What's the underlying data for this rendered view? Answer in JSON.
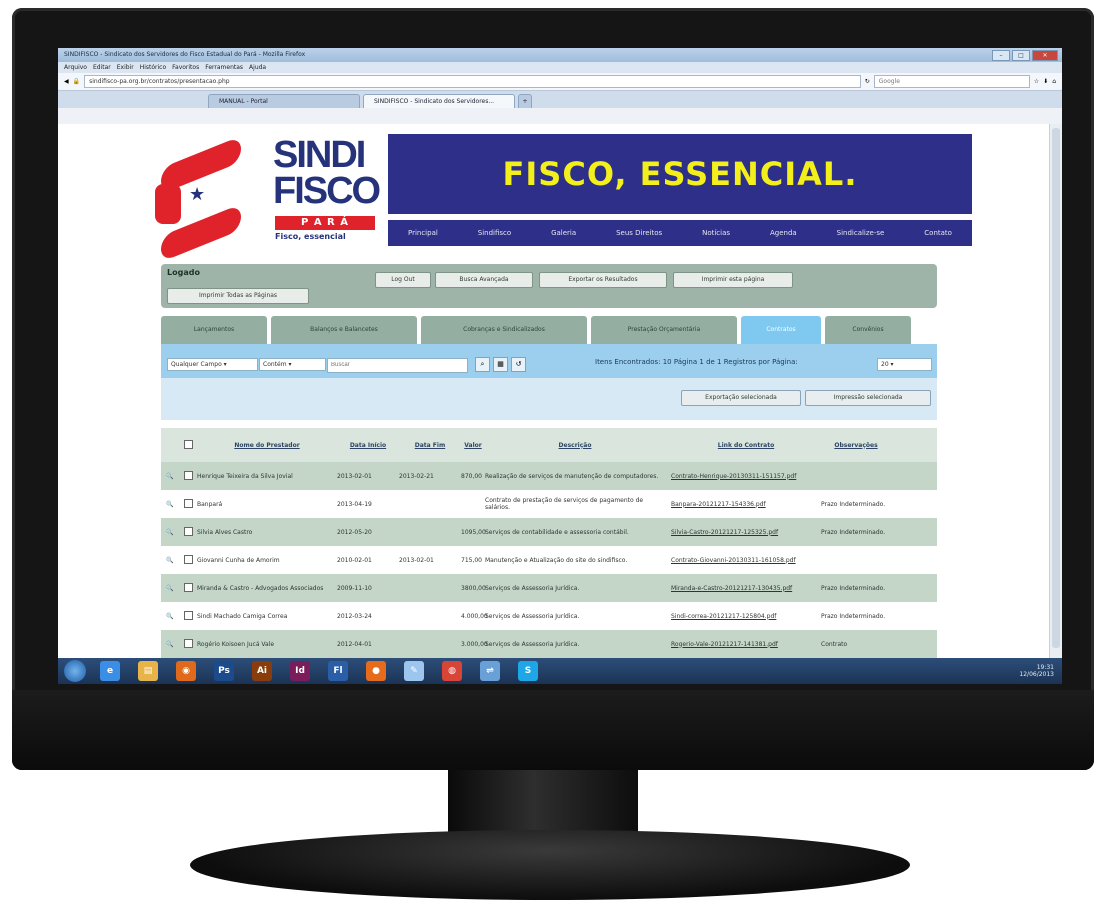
{
  "browser": {
    "window_title": "SINDIFISCO - Sindicato dos Servidores do Fisco Estadual do Pará - Mozilla Firefox",
    "menu": [
      "Arquivo",
      "Editar",
      "Exibir",
      "Histórico",
      "Favoritos",
      "Ferramentas",
      "Ajuda"
    ],
    "url": "sindifisco-pa.org.br/contratos/presentacao.php",
    "search_placeholder": "Google",
    "tabs": [
      {
        "label": "MANUAL - Portal"
      },
      {
        "label": "SINDIFISCO - Sindicato dos Servidores..."
      }
    ]
  },
  "site": {
    "logo": {
      "line1": "SINDI",
      "line2": "FISCO",
      "line3": "P A R Á",
      "tagline": "Fisco, essencial"
    },
    "banner": "FISCO, ESSENCIAL.",
    "nav": [
      "Principal",
      "Sindifisco",
      "Galeria",
      "Seus Direitos",
      "Notícias",
      "Agenda",
      "Sindicalize-se",
      "Contato"
    ]
  },
  "panel": {
    "status_label": "Logado",
    "buttons": [
      "Imprimir Todas as Páginas",
      "Log Out",
      "Busca Avançada",
      "Exportar os Resultados",
      "Imprimir esta página"
    ]
  },
  "subtabs": [
    {
      "label": "Lançamentos",
      "active": false
    },
    {
      "label": "Balanços e Balancetes",
      "active": false
    },
    {
      "label": "Cobranças e Sindicalizados",
      "active": false
    },
    {
      "label": "Prestação Orçamentária",
      "active": false
    },
    {
      "label": "Contratos",
      "active": true
    },
    {
      "label": "Convênios",
      "active": false
    }
  ],
  "filter": {
    "field": "Qualquer Campo",
    "operator": "Contém",
    "search_placeholder": "Buscar",
    "status": "Itens Encontrados: 10  Página 1 de 1   Registros por Página:",
    "per_page": "20"
  },
  "export_buttons": [
    "Exportação selecionada",
    "Impressão selecionada"
  ],
  "table": {
    "headers": [
      "Nome do Prestador",
      "Data Início",
      "Data Fim",
      "Valor",
      "Descrição",
      "Link do Contrato",
      "Observações"
    ],
    "rows": [
      {
        "name": "Henrique Teixeira da Silva Jovial",
        "start": "2013-02-01",
        "end": "2013-02-21",
        "value": "870,00",
        "desc": "Realização de serviços de manutenção de computadores.",
        "link": "Contrato-Henrique-20130311-151157.pdf",
        "obs": ""
      },
      {
        "name": "Banpará",
        "start": "2013-04-19",
        "end": "",
        "value": "",
        "desc": "Contrato de prestação de serviços de pagamento de salários.",
        "link": "Banpara-20121217-154336.pdf",
        "obs": "Prazo Indeterminado."
      },
      {
        "name": "Silvia Alves Castro",
        "start": "2012-05-20",
        "end": "",
        "value": "1095,00",
        "desc": "Serviços de contabilidade e assessoria contábil.",
        "link": "Silvia-Castro-20121217-125325.pdf",
        "obs": "Prazo Indeterminado."
      },
      {
        "name": "Giovanni Cunha de Amorim",
        "start": "2010-02-01",
        "end": "2013-02-01",
        "value": "715,00",
        "desc": "Manutenção e Atualização do site do sindifisco.",
        "link": "Contrato-Giovanni-20130311-161058.pdf",
        "obs": ""
      },
      {
        "name": "Miranda & Castro - Advogados Associados",
        "start": "2009-11-10",
        "end": "",
        "value": "3800,00",
        "desc": "Serviços de Assessoria Jurídica.",
        "link": "Miranda-e-Castro-20121217-130435.pdf",
        "obs": "Prazo Indeterminado."
      },
      {
        "name": "Sindi Machado Camiga Correa",
        "start": "2012-03-24",
        "end": "",
        "value": "4.000,00",
        "desc": "Serviços de Assessoria Jurídica.",
        "link": "Sindi-correa-20121217-125804.pdf",
        "obs": "Prazo Indeterminado."
      },
      {
        "name": "Rogério Koisoen Jucá Vale",
        "start": "2012-04-01",
        "end": "",
        "value": "3.000,00",
        "desc": "Serviços de Assessoria Jurídica.",
        "link": "Rogerio-Vale-20121217-141381.pdf",
        "obs": "Contrato"
      }
    ]
  },
  "taskbar": {
    "clock_time": "19:31",
    "clock_date": "12/06/2013",
    "apps": [
      {
        "icon": "ie-icon",
        "glyph": "e",
        "color": "#3a8ee6"
      },
      {
        "icon": "folder-icon",
        "glyph": "▤",
        "color": "#e8b44a"
      },
      {
        "icon": "media-icon",
        "glyph": "◉",
        "color": "#e06a1c"
      },
      {
        "icon": "photoshop-icon",
        "glyph": "Ps",
        "color": "#1b4b8c"
      },
      {
        "icon": "illustrator-icon",
        "glyph": "Ai",
        "color": "#8a3d0c"
      },
      {
        "icon": "indesign-icon",
        "glyph": "Id",
        "color": "#7b1d5a"
      },
      {
        "icon": "flash-icon",
        "glyph": "Fl",
        "color": "#2a5fa8"
      },
      {
        "icon": "firefox-icon",
        "glyph": "●",
        "color": "#e66b1a"
      },
      {
        "icon": "notes-icon",
        "glyph": "✎",
        "color": "#9cc6ee"
      },
      {
        "icon": "chrome-icon",
        "glyph": "◍",
        "color": "#d84436"
      },
      {
        "icon": "network-icon",
        "glyph": "⇌",
        "color": "#6aa0d8"
      },
      {
        "icon": "skype-icon",
        "glyph": "S",
        "color": "#1fa6e6"
      }
    ]
  },
  "colors": {
    "banner_bg": "#2d2f88",
    "banner_text": "#f3ef1a",
    "logo_red": "#e0232a",
    "active_tab": "#7fc8f0",
    "panel_green": "#9eb4a8"
  }
}
